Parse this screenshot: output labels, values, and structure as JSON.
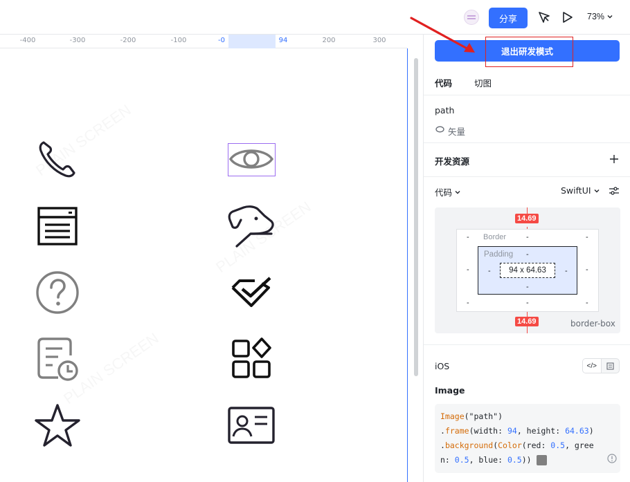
{
  "topbar": {
    "share_label": "分享",
    "zoom_label": "73%"
  },
  "ruler": {
    "ticks": [
      "-400",
      "-300",
      "-200",
      "-100",
      "-0",
      "94",
      "200",
      "300"
    ]
  },
  "canvas": {
    "watermark": "PLAIN SCREEN",
    "icons": [
      "phone-icon",
      "eye-icon",
      "browser-window-icon",
      "dog-icon",
      "help-circle-icon",
      "shield-check-icon",
      "document-clock-icon",
      "apps-grid-icon",
      "star-icon",
      "id-card-icon"
    ]
  },
  "panel": {
    "exit_label": "退出研发模式",
    "tab_code": "代码",
    "tab_slice": "切图",
    "layer_name": "path",
    "layer_type": "矢量",
    "dev_resources": "开发资源",
    "code_label": "代码",
    "framework": "SwiftUI",
    "box": {
      "top_value": "14.69",
      "bottom_value": "14.69",
      "border_label": "Border",
      "padding_label": "Padding",
      "content_size": "94 x 64.63",
      "mode": "border-box",
      "dash": "-"
    },
    "platform": "iOS",
    "section_title": "Image",
    "code": {
      "l1a": "Image",
      "l1b": "(\"path\")",
      "l2a": ".",
      "l2b": "frame",
      "l2c": "(width: ",
      "l2d": "94",
      "l2e": ", height: ",
      "l2f": "64.63",
      "l2g": ")",
      "l3a": ".",
      "l3b": "background",
      "l3c": "(",
      "l3d": "Color",
      "l3e": "(red: ",
      "l3f": "0.5",
      "l3g": ", gree",
      "l4a": "n: ",
      "l4b": "0.5",
      "l4c": ", blue: ",
      "l4d": "0.5",
      "l4e": "))"
    }
  },
  "colors": {
    "accent": "#3370ff",
    "selection": "#9b6cf0",
    "measure": "#f54a45",
    "annotation": "#e02020"
  }
}
